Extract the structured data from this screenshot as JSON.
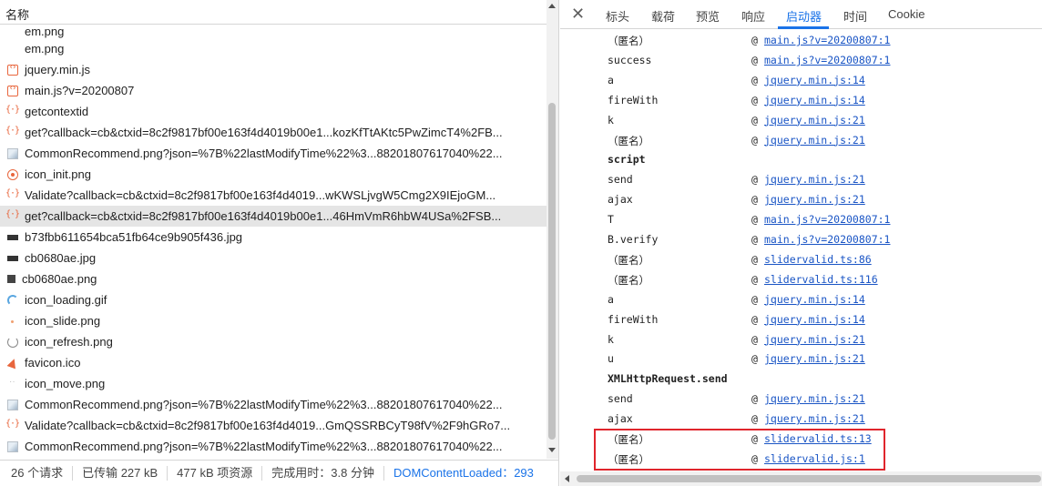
{
  "network": {
    "header_name": "名称",
    "requests": [
      {
        "name": "em.png",
        "icon": "blank-icon"
      },
      {
        "name": "em.png",
        "icon": "blank-icon"
      },
      {
        "name": "jquery.min.js",
        "icon": "script-icon"
      },
      {
        "name": "main.js?v=20200807",
        "icon": "script-icon"
      },
      {
        "name": "getcontextid",
        "icon": "xhr-icon"
      },
      {
        "name": "get?callback=cb&ctxid=8c2f9817bf00e163f4d4019b00e1...kozKfTtAKtc5PwZimcT4%2FB...",
        "icon": "xhr-icon"
      },
      {
        "name": "CommonRecommend.png?json=%7B%22lastModifyTime%22%3...88201807617040%22...",
        "icon": "image-icon"
      },
      {
        "name": "icon_init.png",
        "icon": "init-image-icon"
      },
      {
        "name": "Validate?callback=cb&ctxid=8c2f9817bf00e163f4d4019...wKWSLjvgW5Cmg2X9IEjoGM...",
        "icon": "xhr-icon"
      },
      {
        "name": "get?callback=cb&ctxid=8c2f9817bf00e163f4d4019b00e1...46HmVmR6hbW4USa%2FSB...",
        "icon": "xhr-icon"
      },
      {
        "name": "b73fbb611654bca51fb64ce9b905f436.jpg",
        "icon": "dark-image-icon"
      },
      {
        "name": "cb0680ae.jpg",
        "icon": "dark-image-icon"
      },
      {
        "name": "cb0680ae.png",
        "icon": "puzzle-image-icon"
      },
      {
        "name": "icon_loading.gif",
        "icon": "loading-icon"
      },
      {
        "name": "icon_slide.png",
        "icon": "slide-image-icon"
      },
      {
        "name": "icon_refresh.png",
        "icon": "refresh-image-icon"
      },
      {
        "name": "favicon.ico",
        "icon": "favicon-icon"
      },
      {
        "name": "icon_move.png",
        "icon": "move-image-icon"
      },
      {
        "name": "CommonRecommend.png?json=%7B%22lastModifyTime%22%3...88201807617040%22...",
        "icon": "image-icon"
      },
      {
        "name": "Validate?callback=cb&ctxid=8c2f9817bf00e163f4d4019...GmQSSRBCyT98fV%2F9hGRo7...",
        "icon": "xhr-icon"
      },
      {
        "name": "CommonRecommend.png?json=%7B%22lastModifyTime%22%3...88201807617040%22...",
        "icon": "image-icon"
      }
    ],
    "selected_index": 9,
    "status": {
      "requests": "26 个请求",
      "transferred": "已传输 227 kB",
      "resources": "477 kB 项资源",
      "finish": "完成用时：3.8 分钟",
      "dom_loaded": "DOMContentLoaded：293"
    }
  },
  "details": {
    "close_icon": "close-icon",
    "tabs": [
      "标头",
      "载荷",
      "预览",
      "响应",
      "启动器",
      "时间",
      "Cookie"
    ],
    "active_tab": "启动器",
    "stack": [
      {
        "fn": "（匿名）",
        "link": "main.js?v=20200807:1"
      },
      {
        "fn": "success",
        "link": "main.js?v=20200807:1"
      },
      {
        "fn": "a",
        "link": "jquery.min.js:14"
      },
      {
        "fn": "fireWith",
        "link": "jquery.min.js:14"
      },
      {
        "fn": "k",
        "link": "jquery.min.js:21"
      },
      {
        "fn": "（匿名）",
        "link": "jquery.min.js:21"
      },
      {
        "header": "script"
      },
      {
        "fn": "send",
        "link": "jquery.min.js:21"
      },
      {
        "fn": "ajax",
        "link": "jquery.min.js:21"
      },
      {
        "fn": "T",
        "link": "main.js?v=20200807:1"
      },
      {
        "fn": "B.verify",
        "link": "main.js?v=20200807:1"
      },
      {
        "fn": "（匿名）",
        "link": "slidervalid.ts:86"
      },
      {
        "fn": "（匿名）",
        "link": "slidervalid.ts:116"
      },
      {
        "fn": "a",
        "link": "jquery.min.js:14"
      },
      {
        "fn": "fireWith",
        "link": "jquery.min.js:14"
      },
      {
        "fn": "k",
        "link": "jquery.min.js:21"
      },
      {
        "fn": "u",
        "link": "jquery.min.js:21"
      },
      {
        "header": "XMLHttpRequest.send"
      },
      {
        "fn": "send",
        "link": "jquery.min.js:21"
      },
      {
        "fn": "ajax",
        "link": "jquery.min.js:21"
      },
      {
        "fn": "（匿名）",
        "link": "slidervalid.ts:13"
      },
      {
        "fn": "（匿名）",
        "link": "slidervalid.js:1"
      }
    ],
    "at_symbol": "@"
  },
  "colors": {
    "accent": "#1a73e8",
    "highlight_box": "#e0252c",
    "selected_row": "#e5e5e5"
  }
}
